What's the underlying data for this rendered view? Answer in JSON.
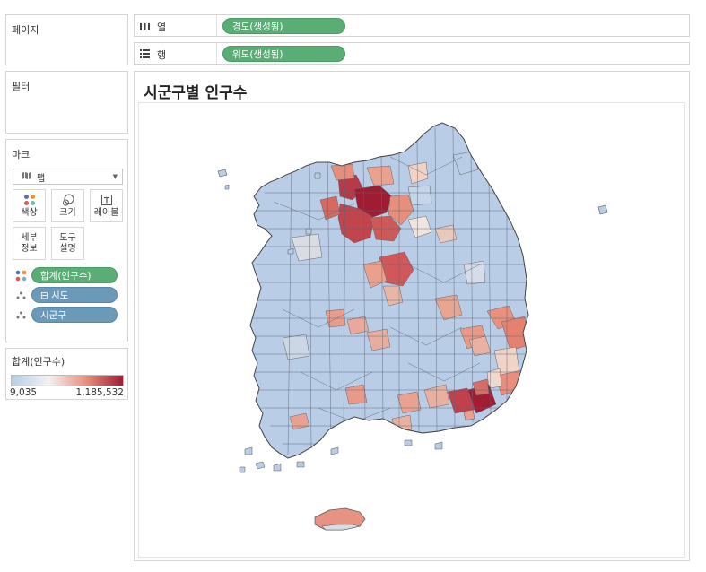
{
  "cards": {
    "pages": {
      "title": "페이지"
    },
    "filters": {
      "title": "필터"
    },
    "marks": {
      "title": "마크",
      "mark_type": "맵",
      "buttons": {
        "color": "색상",
        "size": "크기",
        "label": "레이블",
        "detail_line1": "세부",
        "detail_line2": "정보",
        "tooltip_line1": "도구",
        "tooltip_line2": "설명"
      },
      "pills": [
        {
          "label": "합계(인구수)",
          "icon": "color-dots-icon",
          "color": "#5aae75"
        },
        {
          "label": "⊟ 시도",
          "icon": "detail-icon",
          "color": "#6a9ab8"
        },
        {
          "label": "시군구",
          "icon": "detail-icon",
          "color": "#6a9ab8"
        }
      ]
    },
    "legend": {
      "title": "합계(인구수)",
      "min_label": "9,035",
      "max_label": "1,185,532",
      "colors": [
        "#b8cde6",
        "#f2f2f2",
        "#e8917f",
        "#a01c33"
      ]
    }
  },
  "shelves": {
    "columns": {
      "label": "열",
      "icon": "columns-icon",
      "pill": "경도(생성됨)"
    },
    "rows": {
      "label": "행",
      "icon": "rows-icon",
      "pill": "위도(생성됨)"
    }
  },
  "view": {
    "title": "시군구별 인구수"
  }
}
